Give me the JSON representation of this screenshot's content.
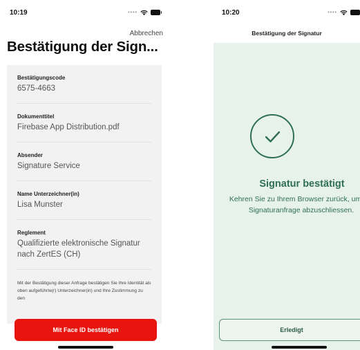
{
  "left_screen": {
    "status_time": "10:19",
    "cancel_label": "Abbrechen",
    "title": "Bestätigung der Sign...",
    "fields": [
      {
        "label": "Bestätigungscode",
        "value": "6575-4663"
      },
      {
        "label": "Dokumenttitel",
        "value": "Firebase App Distribution.pdf"
      },
      {
        "label": "Absender",
        "value": "Signature Service"
      },
      {
        "label": "Name Unterzeichner(in)",
        "value": "Lisa Munster"
      },
      {
        "label": "Reglement",
        "value": "Qualifizierte elektronische Signatur nach ZertES (CH)"
      }
    ],
    "disclaimer": "Mit der Bestätigung dieser Anfrage bestätigen Sie Ihre Identität als oben aufgeführte(r) Unterzeichner(in) und Ihre Zustimmung zu den",
    "faceid_button_label": "Mit Face ID bestätigen",
    "accent_color": "#e8150f"
  },
  "right_screen": {
    "status_time": "10:20",
    "nav_title": "Bestätigung der Signatur",
    "success_title": "Signatur bestätigt",
    "success_message": "Kehren Sie zu Ihrem Browser zurück, um die Signaturanfrage abzuschliessen.",
    "done_button_label": "Erledigt",
    "panel_color": "#e8f2ec",
    "accent_color": "#2f6f52"
  }
}
